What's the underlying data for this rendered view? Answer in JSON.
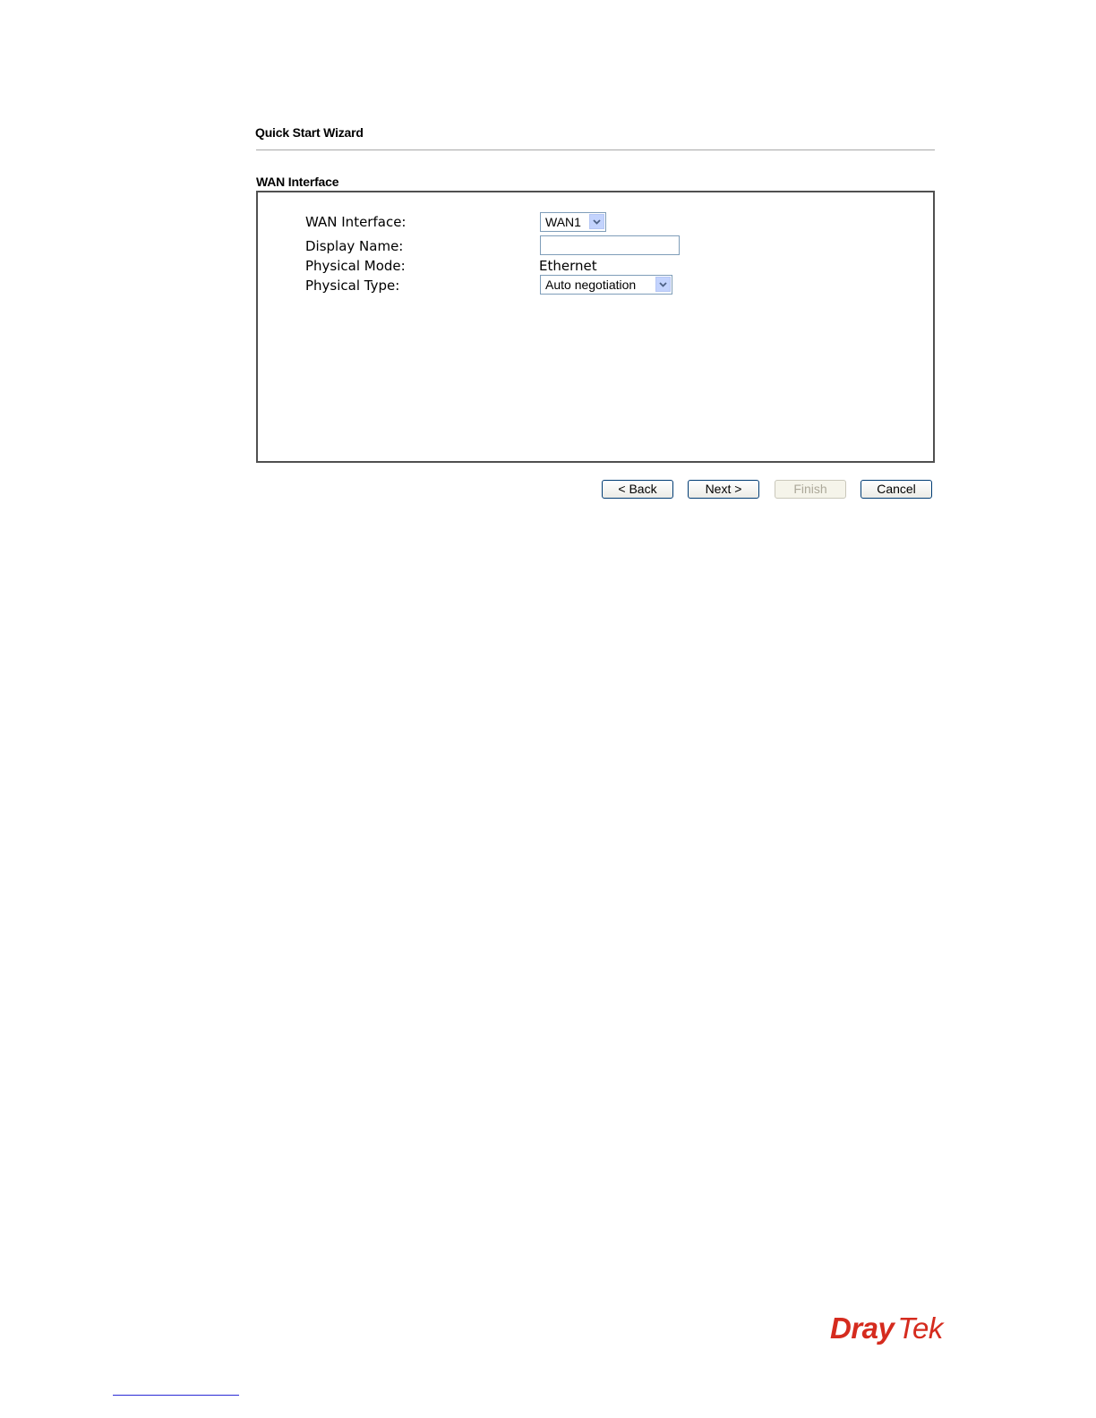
{
  "header": {
    "title": "Quick Start Wizard"
  },
  "section": {
    "title": "WAN Interface"
  },
  "form": {
    "wan_interface": {
      "label": "WAN Interface:",
      "value": "WAN1"
    },
    "display_name": {
      "label": "Display Name:",
      "value": ""
    },
    "physical_mode": {
      "label": "Physical Mode:",
      "value": "Ethernet"
    },
    "physical_type": {
      "label": "Physical Type:",
      "value": "Auto negotiation"
    }
  },
  "buttons": {
    "back": "< Back",
    "next": "Next >",
    "finish": "Finish",
    "cancel": "Cancel"
  },
  "footer": {
    "logo_part1": "Dray",
    "logo_part2": "Tek"
  },
  "colors": {
    "logo": "#d52b1e",
    "input_border": "#7f9db9",
    "dropdown_arrow_bg": "#c3d3fd",
    "button_border": "#003c74",
    "footer_line": "#2b2bd6"
  },
  "icons": {
    "dropdown_arrow": "chevron-down-icon"
  }
}
